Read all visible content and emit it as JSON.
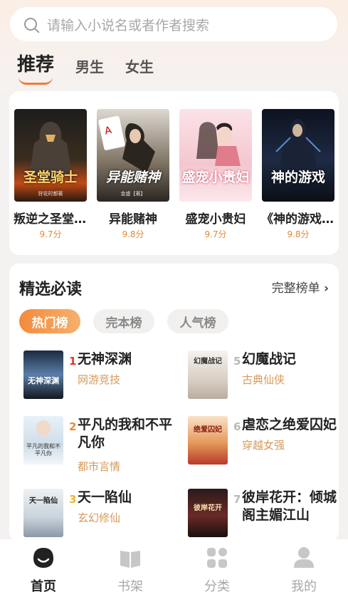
{
  "search": {
    "placeholder": "请输入小说名或者作者搜索"
  },
  "tabs": [
    {
      "label": "推荐"
    },
    {
      "label": "男生"
    },
    {
      "label": "女生"
    }
  ],
  "recommended": [
    {
      "title": "叛逆之圣堂...",
      "score": "9.7分",
      "cover_text": "圣堂骑士",
      "cover_sub": "狩花时都著"
    },
    {
      "title": "异能赌神",
      "score": "9.8分",
      "cover_text": "异能赌神",
      "cover_sub": "金盛【著】"
    },
    {
      "title": "盛宠小贵妇",
      "score": "9.7分",
      "cover_text": "盛宠小贵妇",
      "cover_sub": ""
    },
    {
      "title": "《神的游戏...",
      "score": "9.8分",
      "cover_text": "神的游戏",
      "cover_sub": ""
    }
  ],
  "selected": {
    "title": "精选必读",
    "more": "完整榜单",
    "pills": [
      {
        "label": "热门榜"
      },
      {
        "label": "完本榜"
      },
      {
        "label": "人气榜"
      }
    ],
    "ranks": [
      {
        "num": "1",
        "name": "无神深渊",
        "genre": "网游竞技",
        "cover_text": "无神深渊"
      },
      {
        "num": "2",
        "name": "平凡的我和不平凡你",
        "genre": "都市言情",
        "cover_text": "平凡的我和不平凡你"
      },
      {
        "num": "3",
        "name": "天一陷仙",
        "genre": "玄幻修仙",
        "cover_text": "天一陷仙"
      },
      {
        "num": "5",
        "name": "幻魔战记",
        "genre": "古典仙侠",
        "cover_text": "幻魔战记"
      },
      {
        "num": "6",
        "name": "虐恋之绝爱囚妃",
        "genre": "穿越女强",
        "cover_text": "绝爱囚妃"
      },
      {
        "num": "7",
        "name": "彼岸花开：倾城阁主媚江山",
        "genre": "",
        "cover_text": "彼岸花开"
      }
    ]
  },
  "nav": [
    {
      "label": "首页"
    },
    {
      "label": "书架"
    },
    {
      "label": "分类"
    },
    {
      "label": "我的"
    }
  ],
  "colors": {
    "accent": "#f07a3a",
    "score": "#e08a3a",
    "rank_top": "#e0392e",
    "rank_other": "#b9b9b9"
  }
}
